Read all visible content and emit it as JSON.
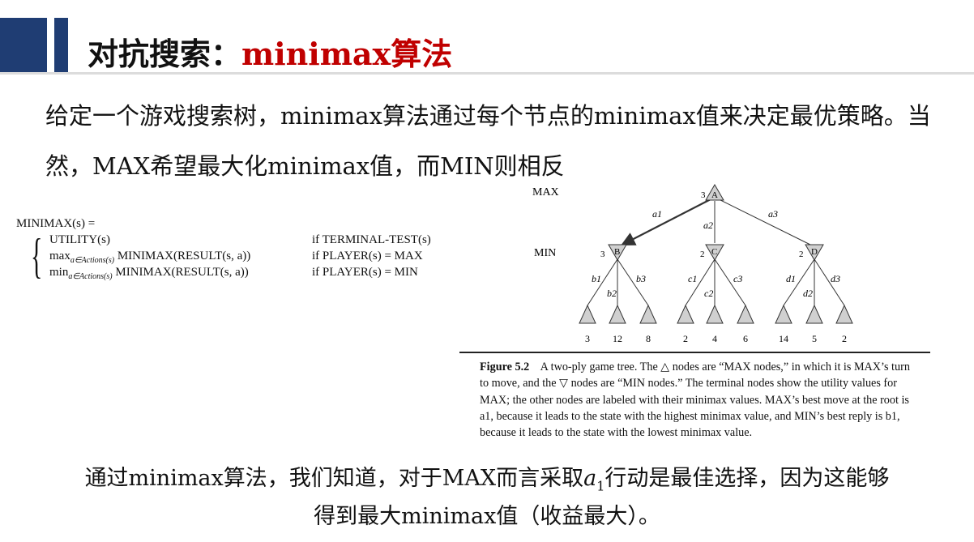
{
  "header": {
    "title_prefix": "对抗搜索：",
    "title_accent": "minimax算法"
  },
  "intro": {
    "text": "给定一个游戏搜索树，minimax算法通过每个节点的minimax值来决定最优策略。当然，MAX希望最大化minimax值，而MIN则相反"
  },
  "formula": {
    "lhs": "MINIMAX(s) =",
    "cases": [
      {
        "expr": "UTILITY(s)",
        "cond": "if TERMINAL-TEST(s)"
      },
      {
        "expr_head": "max",
        "expr_sub": "a∈Actions(s)",
        "expr_tail": " MINIMAX(RESULT(s, a))",
        "cond": "if PLAYER(s) = MAX"
      },
      {
        "expr_head": "min",
        "expr_sub": "a∈Actions(s)",
        "expr_tail": " MINIMAX(RESULT(s, a))",
        "cond": "if PLAYER(s) = MIN"
      }
    ]
  },
  "tree": {
    "level_labels": {
      "max": "MAX",
      "min": "MIN"
    },
    "root": {
      "label": "A",
      "value": "3"
    },
    "edge_labels_top": [
      "a1",
      "a2",
      "a3"
    ],
    "min_nodes": [
      {
        "label": "B",
        "value": "3",
        "edges": [
          "b1",
          "b2",
          "b3"
        ],
        "leaves": [
          "3",
          "12",
          "8"
        ]
      },
      {
        "label": "C",
        "value": "2",
        "edges": [
          "c1",
          "c2",
          "c3"
        ],
        "leaves": [
          "2",
          "4",
          "6"
        ]
      },
      {
        "label": "D",
        "value": "2",
        "edges": [
          "d1",
          "d2",
          "d3"
        ],
        "leaves": [
          "14",
          "5",
          "2"
        ]
      }
    ]
  },
  "caption": {
    "label": "Figure 5.2",
    "text": "A two-ply game tree. The △ nodes are “MAX nodes,” in which it is MAX’s turn to move, and the ▽ nodes are “MIN nodes.” The terminal nodes show the utility values for MAX; the other nodes are labeled with their minimax values. MAX’s best move at the root is a1, because it leads to the state with the highest minimax value, and MIN’s best reply is b1, because it leads to the state with the lowest minimax value."
  },
  "conclusion": {
    "line1_pre": "通过minimax算法，我们知道，对于MAX而言采取",
    "line1_var": "a",
    "line1_sub": "1",
    "line1_post": "行动是最佳选择，因为这能够",
    "line2": "得到最大minimax值（收益最大）。"
  },
  "colors": {
    "brand_bar": "#1f3d73",
    "accent": "#c00000",
    "node_fill": "#d0d0d0"
  }
}
